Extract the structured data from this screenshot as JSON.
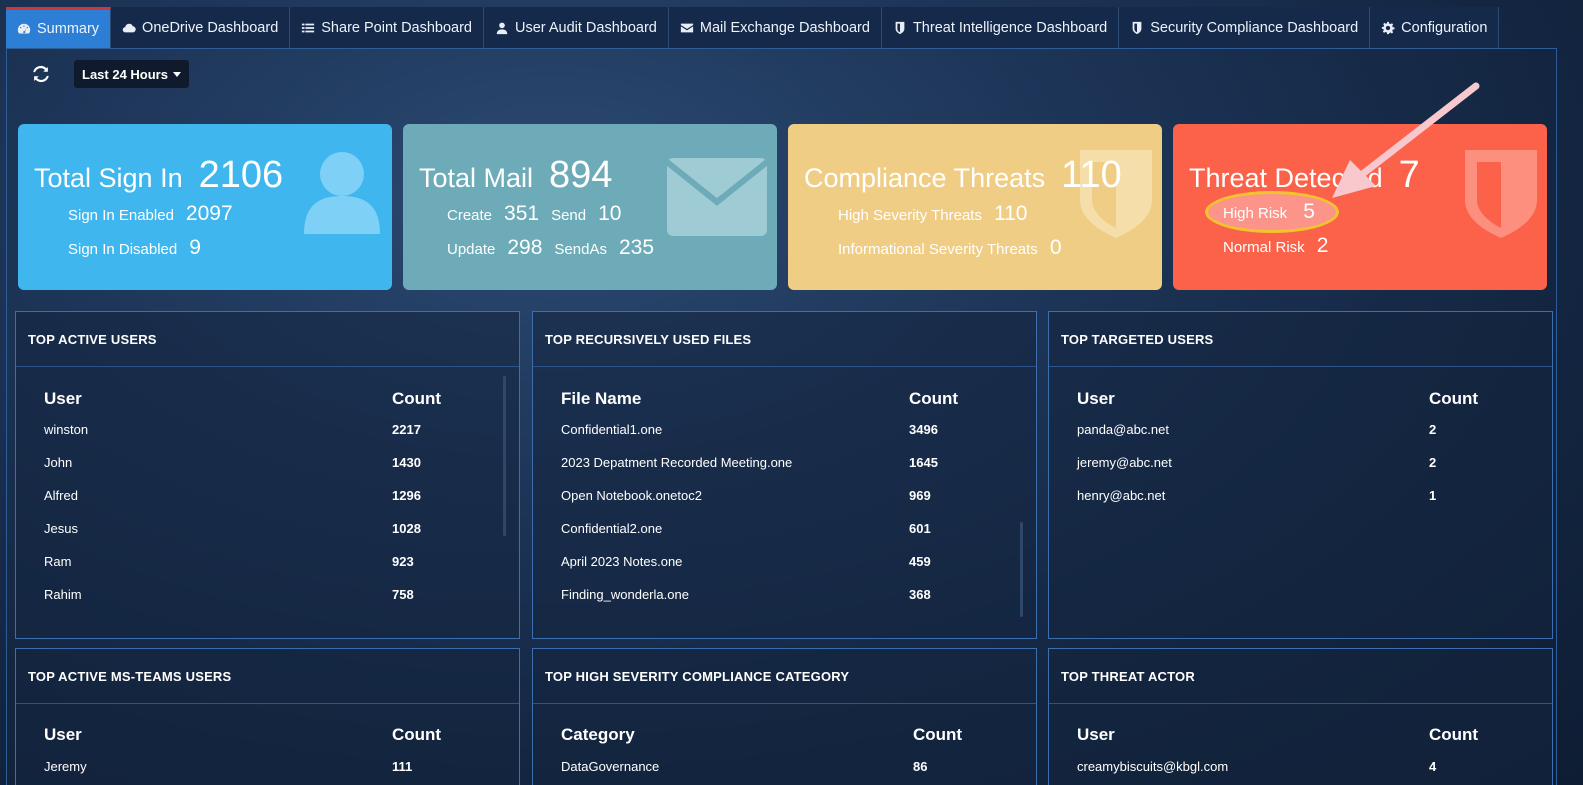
{
  "nav": {
    "tabs": [
      {
        "label": "Summary",
        "icon": "dashboard-icon"
      },
      {
        "label": "OneDrive Dashboard",
        "icon": "cloud-icon"
      },
      {
        "label": "Share Point Dashboard",
        "icon": "list-icon"
      },
      {
        "label": "User Audit Dashboard",
        "icon": "user-icon"
      },
      {
        "label": "Mail Exchange Dashboard",
        "icon": "envelope-icon"
      },
      {
        "label": "Threat Intelligence Dashboard",
        "icon": "shield-icon"
      },
      {
        "label": "Security Compliance Dashboard",
        "icon": "shield-icon"
      },
      {
        "label": "Configuration",
        "icon": "gear-icon"
      }
    ],
    "active_tab": "Summary"
  },
  "toolbar": {
    "refresh_icon": "refresh-icon",
    "time_range": "Last 24 Hours"
  },
  "cards": {
    "signin": {
      "title": "Total Sign In",
      "total": "2106",
      "enabled_label": "Sign In Enabled",
      "enabled": "2097",
      "disabled_label": "Sign In Disabled",
      "disabled": "9",
      "color": "#3fb6ee",
      "icon": "user-icon"
    },
    "mail": {
      "title": "Total Mail",
      "total": "894",
      "create_label": "Create",
      "create": "351",
      "send_label": "Send",
      "send": "10",
      "update_label": "Update",
      "update": "298",
      "sendas_label": "SendAs",
      "sendas": "235",
      "color": "#6dabb8",
      "icon": "envelope-icon"
    },
    "compliance": {
      "title": "Compliance Threats",
      "total": "110",
      "high_label": "High Severity Threats",
      "high": "110",
      "info_label": "Informational Severity Threats",
      "info": "0",
      "color": "#f0cd85",
      "icon": "shield-icon"
    },
    "threat": {
      "title": "Threat Detected",
      "total": "7",
      "high_label": "High Risk",
      "high": "5",
      "normal_label": "Normal Risk",
      "normal": "2",
      "color": "#fb6249",
      "icon": "shield-icon"
    }
  },
  "panels": {
    "active_users": {
      "title": "TOP ACTIVE USERS",
      "headers": [
        "User",
        "Count"
      ],
      "rows": [
        [
          "winston",
          "2217"
        ],
        [
          "John",
          "1430"
        ],
        [
          "Alfred",
          "1296"
        ],
        [
          "Jesus",
          "1028"
        ],
        [
          "Ram",
          "923"
        ],
        [
          "Rahim",
          "758"
        ]
      ]
    },
    "files": {
      "title": "TOP RECURSIVELY USED FILES",
      "headers": [
        "File Name",
        "Count"
      ],
      "rows": [
        [
          "Confidential1.one",
          "3496"
        ],
        [
          "2023 Depatment Recorded Meeting.one",
          "1645"
        ],
        [
          "Open Notebook.onetoc2",
          "969"
        ],
        [
          "Confidential2.one",
          "601"
        ],
        [
          "April 2023 Notes.one",
          "459"
        ],
        [
          "Finding_wonderla.one",
          "368"
        ]
      ]
    },
    "targeted": {
      "title": "TOP TARGETED USERS",
      "headers": [
        "User",
        "Count"
      ],
      "rows": [
        [
          "panda@abc.net",
          "2"
        ],
        [
          "jeremy@abc.net",
          "2"
        ],
        [
          "henry@abc.net",
          "1"
        ]
      ]
    },
    "teams": {
      "title": "TOP ACTIVE MS-TEAMS USERS",
      "headers": [
        "User",
        "Count"
      ],
      "rows": [
        [
          "Jeremy",
          "111"
        ]
      ]
    },
    "compliance_cat": {
      "title": "TOP HIGH SEVERITY COMPLIANCE CATEGORY",
      "headers": [
        "Category",
        "Count"
      ],
      "rows": [
        [
          "DataGovernance",
          "86"
        ]
      ]
    },
    "threat_actor": {
      "title": "TOP THREAT ACTOR",
      "headers": [
        "User",
        "Count"
      ],
      "rows": [
        [
          "creamybiscuits@kbgl.com",
          "4"
        ]
      ]
    }
  },
  "annotation": {
    "type": "arrow",
    "target": "High Risk"
  }
}
